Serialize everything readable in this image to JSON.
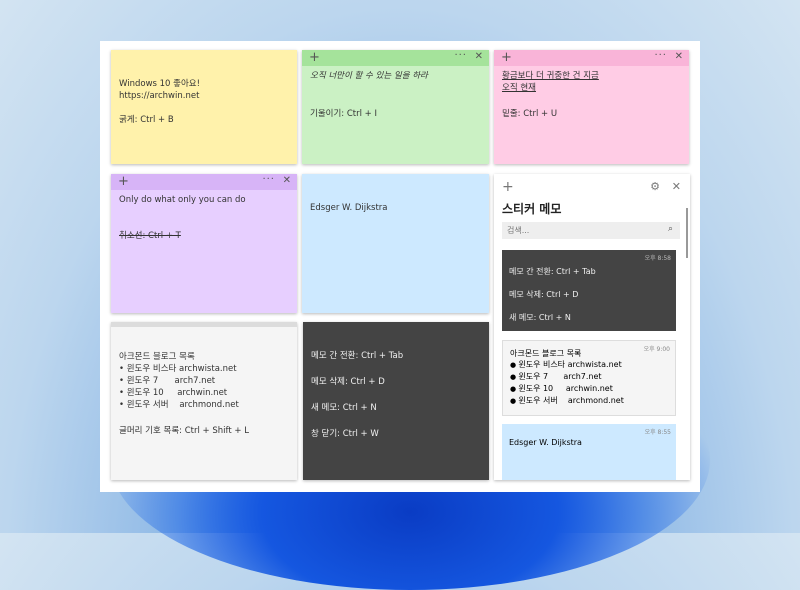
{
  "notes": {
    "yellow": {
      "lines": [
        "Windows 10 좋아요!",
        "https://archwin.net",
        "",
        "굵게: Ctrl + B"
      ]
    },
    "green": {
      "lines": [
        "오직 너만이 할 수 있는 일을 하라",
        "",
        "기울이기: Ctrl + I"
      ]
    },
    "pink": {
      "lines": [
        "황금보다 더 귀중한 건 지금",
        "오직 현재",
        "",
        "밑줄: Ctrl + U"
      ]
    },
    "purple": {
      "lines": [
        "Only do what only you can do",
        "",
        "",
        "취소선: Ctrl + T"
      ]
    },
    "blue": {
      "lines": [
        "Edsger W. Dijkstra"
      ]
    },
    "white": {
      "title": "아크몬드 블로그 목록",
      "items": [
        "윈도우 비스타 archwista.net",
        "윈도우 7      arch7.net",
        "윈도우 10     archwin.net",
        "윈도우 서버    archmond.net"
      ],
      "footer": "글머리 기호 목록: Ctrl + Shift + L"
    },
    "dark": {
      "lines": [
        "메모 간 전환: Ctrl + Tab",
        "",
        "메모 삭제: Ctrl + D",
        "",
        "새 메모: Ctrl + N",
        "",
        "창 닫기: Ctrl + W"
      ]
    }
  },
  "icons": {
    "plus": "+",
    "more": "···",
    "close": "✕",
    "gear": "⚙",
    "search": "⌕"
  },
  "list_panel": {
    "title": "스티커 메모",
    "search_placeholder": "검색...",
    "cards": [
      {
        "color": "dark",
        "time": "오후 8:58",
        "lines": [
          "메모 간 전환: Ctrl + Tab",
          "메모 삭제: Ctrl + D",
          "새 메모: Ctrl + N"
        ]
      },
      {
        "color": "white",
        "time": "오후 9:00",
        "title": "아크몬드 블로그 목록",
        "items": [
          "윈도우 비스타 archwista.net",
          "윈도우 7      arch7.net",
          "윈도우 10     archwin.net",
          "윈도우 서버    archmond.net"
        ]
      },
      {
        "color": "blue",
        "time": "오후 8:55",
        "lines": [
          "Edsger W. Dijkstra"
        ]
      }
    ]
  },
  "colors": {
    "yellow": "#fff2ab",
    "green": "#cbf1c4",
    "pink": "#ffcce5",
    "purple": "#e7cfff",
    "blue": "#cde9ff",
    "white": "#f5f5f5",
    "dark": "#444444"
  }
}
